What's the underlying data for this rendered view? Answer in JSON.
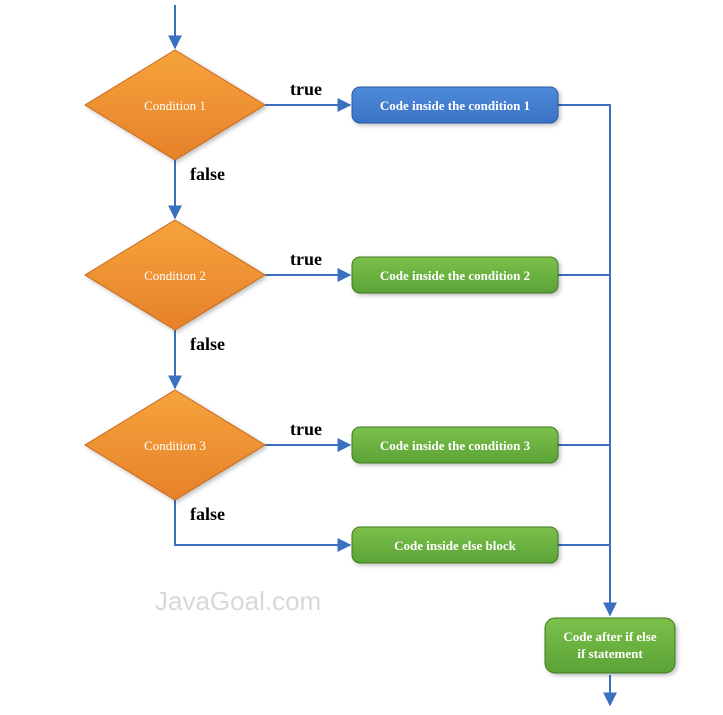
{
  "chart_data": {
    "type": "flowchart",
    "nodes": [
      {
        "id": "cond1",
        "kind": "decision",
        "label": "Condition 1"
      },
      {
        "id": "code1",
        "kind": "process",
        "label": "Code inside the condition 1",
        "color": "blue"
      },
      {
        "id": "cond2",
        "kind": "decision",
        "label": "Condition 2"
      },
      {
        "id": "code2",
        "kind": "process",
        "label": "Code inside the condition 2",
        "color": "green"
      },
      {
        "id": "cond3",
        "kind": "decision",
        "label": "Condition 3"
      },
      {
        "id": "code3",
        "kind": "process",
        "label": "Code inside the condition 3",
        "color": "green"
      },
      {
        "id": "codeElse",
        "kind": "process",
        "label": "Code inside else block",
        "color": "green"
      },
      {
        "id": "after",
        "kind": "process",
        "label_line1": "Code after if else",
        "label_line2": "if statement",
        "color": "green"
      }
    ],
    "edges": [
      {
        "from": "start",
        "to": "cond1"
      },
      {
        "from": "cond1",
        "to": "code1",
        "label": "true"
      },
      {
        "from": "cond1",
        "to": "cond2",
        "label": "false"
      },
      {
        "from": "cond2",
        "to": "code2",
        "label": "true"
      },
      {
        "from": "cond2",
        "to": "cond3",
        "label": "false"
      },
      {
        "from": "cond3",
        "to": "code3",
        "label": "true"
      },
      {
        "from": "cond3",
        "to": "codeElse",
        "label": "false"
      },
      {
        "from": "code1",
        "to": "after"
      },
      {
        "from": "code2",
        "to": "after"
      },
      {
        "from": "code3",
        "to": "after"
      },
      {
        "from": "codeElse",
        "to": "after"
      },
      {
        "from": "after",
        "to": "end"
      }
    ]
  },
  "labels": {
    "cond1": "Condition 1",
    "cond2": "Condition 2",
    "cond3": "Condition 3",
    "code1": "Code inside the condition 1",
    "code2": "Code inside the condition 2",
    "code3": "Code inside the condition 3",
    "codeElse": "Code inside else block",
    "after1": "Code after if else",
    "after2": "if statement",
    "true": "true",
    "false": "false",
    "watermark": "JavaGoal.com"
  }
}
